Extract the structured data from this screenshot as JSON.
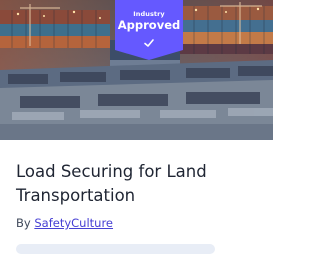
{
  "card": {
    "badge": {
      "small_text": "Industry",
      "big_text": "Approved",
      "color": "#6559ff"
    },
    "title": "Load Securing for Land Transportation",
    "author_prefix": "By",
    "author_name": "SafetyCulture",
    "image": "shipping-container-port-photo",
    "colors": {
      "accent": "#4740d4",
      "title": "#1f2533",
      "text": "#3f495a",
      "progress_track": "#e8edf6"
    }
  }
}
